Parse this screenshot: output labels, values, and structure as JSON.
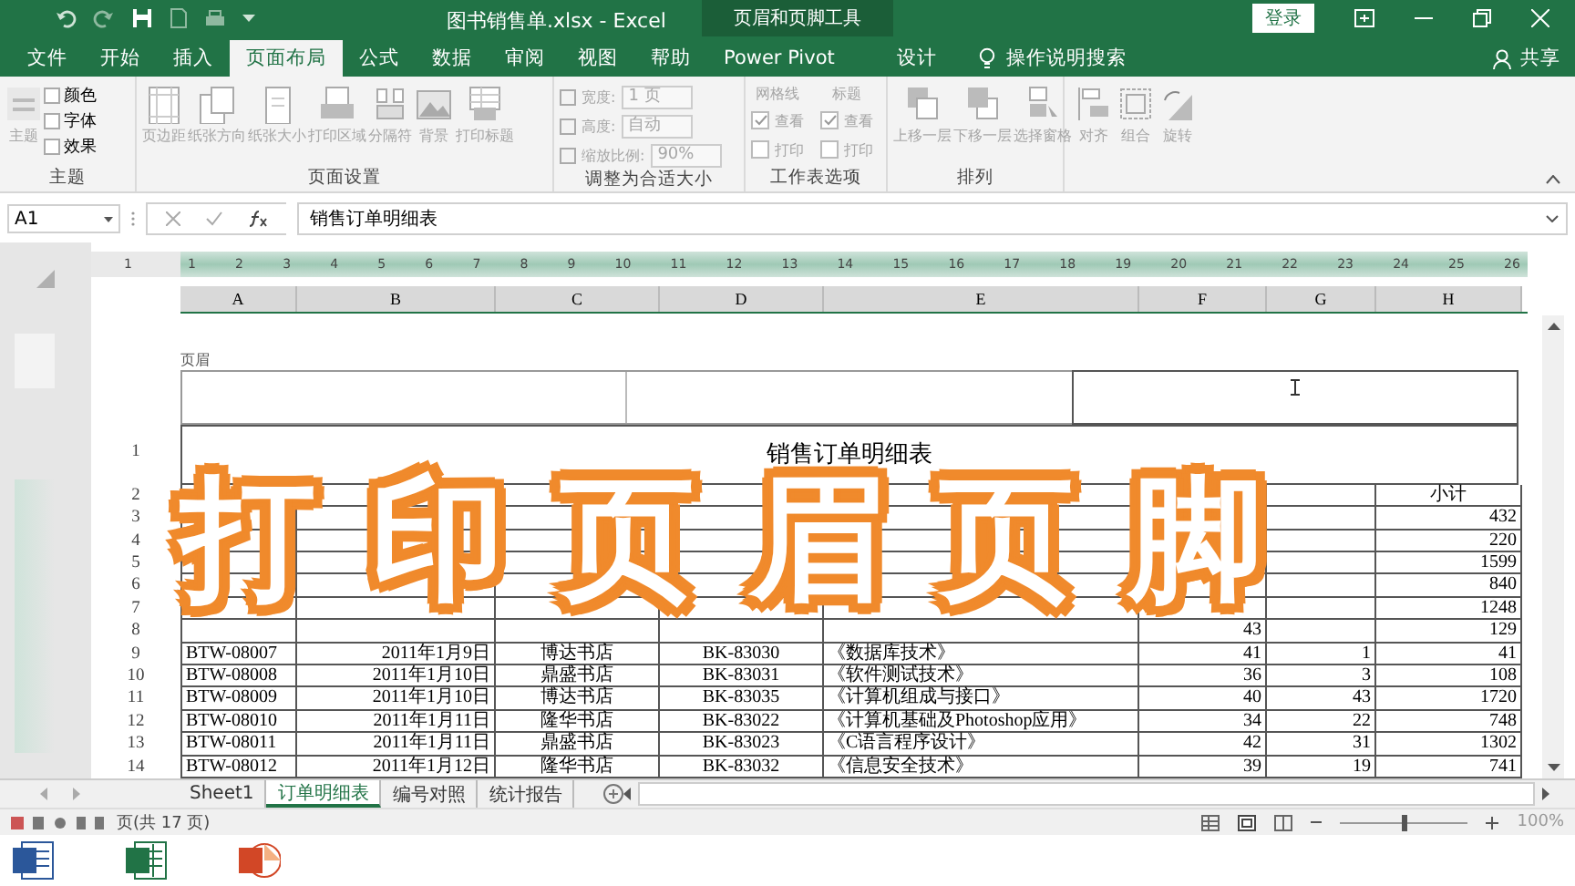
{
  "window": {
    "title": "图书销售单.xlsx - Excel",
    "context_group": "页眉和页脚工具",
    "login_button": "登录"
  },
  "menu_tabs": [
    {
      "label": "文件",
      "selected": false
    },
    {
      "label": "开始",
      "selected": false
    },
    {
      "label": "插入",
      "selected": false
    },
    {
      "label": "页面布局",
      "selected": true
    },
    {
      "label": "公式",
      "selected": false
    },
    {
      "label": "数据",
      "selected": false
    },
    {
      "label": "审阅",
      "selected": false
    },
    {
      "label": "视图",
      "selected": false
    },
    {
      "label": "帮助",
      "selected": false
    },
    {
      "label": "Power Pivot",
      "selected": false
    },
    {
      "label": "设计",
      "selected": false
    }
  ],
  "tell_me": "操作说明搜索",
  "share": "共享",
  "ribbon": [
    {
      "name": "主题",
      "disabled": true,
      "items": [
        {
          "kind": "large",
          "label": "主题"
        },
        {
          "kind": "small",
          "label": "颜色"
        },
        {
          "kind": "small",
          "label": "字体"
        },
        {
          "kind": "small",
          "label": "效果"
        }
      ]
    },
    {
      "name": "页面设置",
      "disabled": true,
      "items": [
        {
          "kind": "large",
          "label": "页边距"
        },
        {
          "kind": "large",
          "label": "纸张方向"
        },
        {
          "kind": "large",
          "label": "纸张大小"
        },
        {
          "kind": "large",
          "label": "打印区域"
        },
        {
          "kind": "large",
          "label": "分隔符"
        },
        {
          "kind": "large",
          "label": "背景"
        },
        {
          "kind": "large",
          "label": "打印标题"
        }
      ]
    },
    {
      "name": "调整为合适大小",
      "disabled": true,
      "items": [
        {
          "kind": "spin",
          "label": "宽度:",
          "value": "1 页"
        },
        {
          "kind": "spin",
          "label": "高度:",
          "value": "自动"
        },
        {
          "kind": "spin",
          "label": "缩放比例:",
          "value": "90%"
        }
      ]
    },
    {
      "name": "工作表选项",
      "disabled": true,
      "items": [
        {
          "kind": "options",
          "label": "网格线",
          "options": [
            {
              "label": "查看",
              "checked": true
            },
            {
              "label": "打印",
              "checked": false
            }
          ]
        },
        {
          "kind": "options",
          "label": "标题",
          "options": [
            {
              "label": "查看",
              "checked": true
            },
            {
              "label": "打印",
              "checked": false
            }
          ]
        }
      ]
    },
    {
      "name": "排列",
      "disabled": true,
      "items": [
        {
          "kind": "large",
          "label": "上移一层"
        },
        {
          "kind": "large",
          "label": "下移一层"
        },
        {
          "kind": "large",
          "label": "选择窗格"
        },
        {
          "kind": "large",
          "label": "对齐"
        },
        {
          "kind": "large",
          "label": "组合"
        },
        {
          "kind": "large",
          "label": "旋转"
        }
      ]
    }
  ],
  "formula_bar": {
    "name_box": "A1",
    "formula": "销售订单明细表"
  },
  "ruler": [
    "1",
    "1",
    "2",
    "3",
    "4",
    "5",
    "6",
    "7",
    "8",
    "9",
    "10",
    "11",
    "12",
    "13",
    "14",
    "15",
    "16",
    "17",
    "18",
    "19",
    "20",
    "21",
    "22",
    "23",
    "24",
    "25",
    "26"
  ],
  "columns": [
    "A",
    "B",
    "C",
    "D",
    "E",
    "F",
    "G",
    "H"
  ],
  "page": {
    "header_label": "页眉",
    "title_row": {
      "number": "1",
      "text": "销售订单明细表"
    },
    "rows": [
      {
        "number": "2",
        "cells": [
          null,
          null,
          null,
          null,
          null,
          null,
          null,
          "小计"
        ]
      },
      {
        "number": "3",
        "cells": [
          null,
          null,
          null,
          null,
          null,
          null,
          null,
          "432"
        ]
      },
      {
        "number": "4",
        "cells": [
          null,
          null,
          null,
          null,
          null,
          null,
          null,
          "220"
        ]
      },
      {
        "number": "5",
        "cells": [
          null,
          null,
          null,
          null,
          null,
          null,
          null,
          "1599"
        ]
      },
      {
        "number": "6",
        "cells": [
          null,
          null,
          null,
          null,
          null,
          null,
          null,
          "840"
        ]
      },
      {
        "number": "7",
        "cells": [
          null,
          null,
          null,
          null,
          null,
          null,
          null,
          "1248"
        ]
      },
      {
        "number": "8",
        "cells": [
          null,
          null,
          null,
          null,
          null,
          "43",
          null,
          "129"
        ]
      },
      {
        "number": "9",
        "cells": [
          "BTW-08007",
          "2011年1月9日",
          "博达书店",
          "BK-83030",
          "《数据库技术》",
          "41",
          "1",
          "41"
        ]
      },
      {
        "number": "10",
        "cells": [
          "BTW-08008",
          "2011年1月10日",
          "鼎盛书店",
          "BK-83031",
          "《软件测试技术》",
          "36",
          "3",
          "108"
        ]
      },
      {
        "number": "11",
        "cells": [
          "BTW-08009",
          "2011年1月10日",
          "博达书店",
          "BK-83035",
          "《计算机组成与接口》",
          "40",
          "43",
          "1720"
        ]
      },
      {
        "number": "12",
        "cells": [
          "BTW-08010",
          "2011年1月11日",
          "隆华书店",
          "BK-83022",
          "《计算机基础及Photoshop应用》",
          "34",
          "22",
          "748"
        ]
      },
      {
        "number": "13",
        "cells": [
          "BTW-08011",
          "2011年1月11日",
          "鼎盛书店",
          "BK-83023",
          "《C语言程序设计》",
          "42",
          "31",
          "1302"
        ]
      },
      {
        "number": "14",
        "cells": [
          "BTW-08012",
          "2011年1月12日",
          "隆华书店",
          "BK-83032",
          "《信息安全技术》",
          "39",
          "19",
          "741"
        ]
      }
    ]
  },
  "sheet_tabs": [
    {
      "label": "Sheet1",
      "selected": false
    },
    {
      "label": "订单明细表",
      "selected": true
    },
    {
      "label": "编号对照",
      "selected": false
    },
    {
      "label": "统计报告",
      "selected": false
    }
  ],
  "status_bar": {
    "page_info": "页(共 17 页)",
    "zoom_slider": {
      "level": 0.5
    },
    "zoom": "100%"
  },
  "caption": "打印页眉页脚"
}
